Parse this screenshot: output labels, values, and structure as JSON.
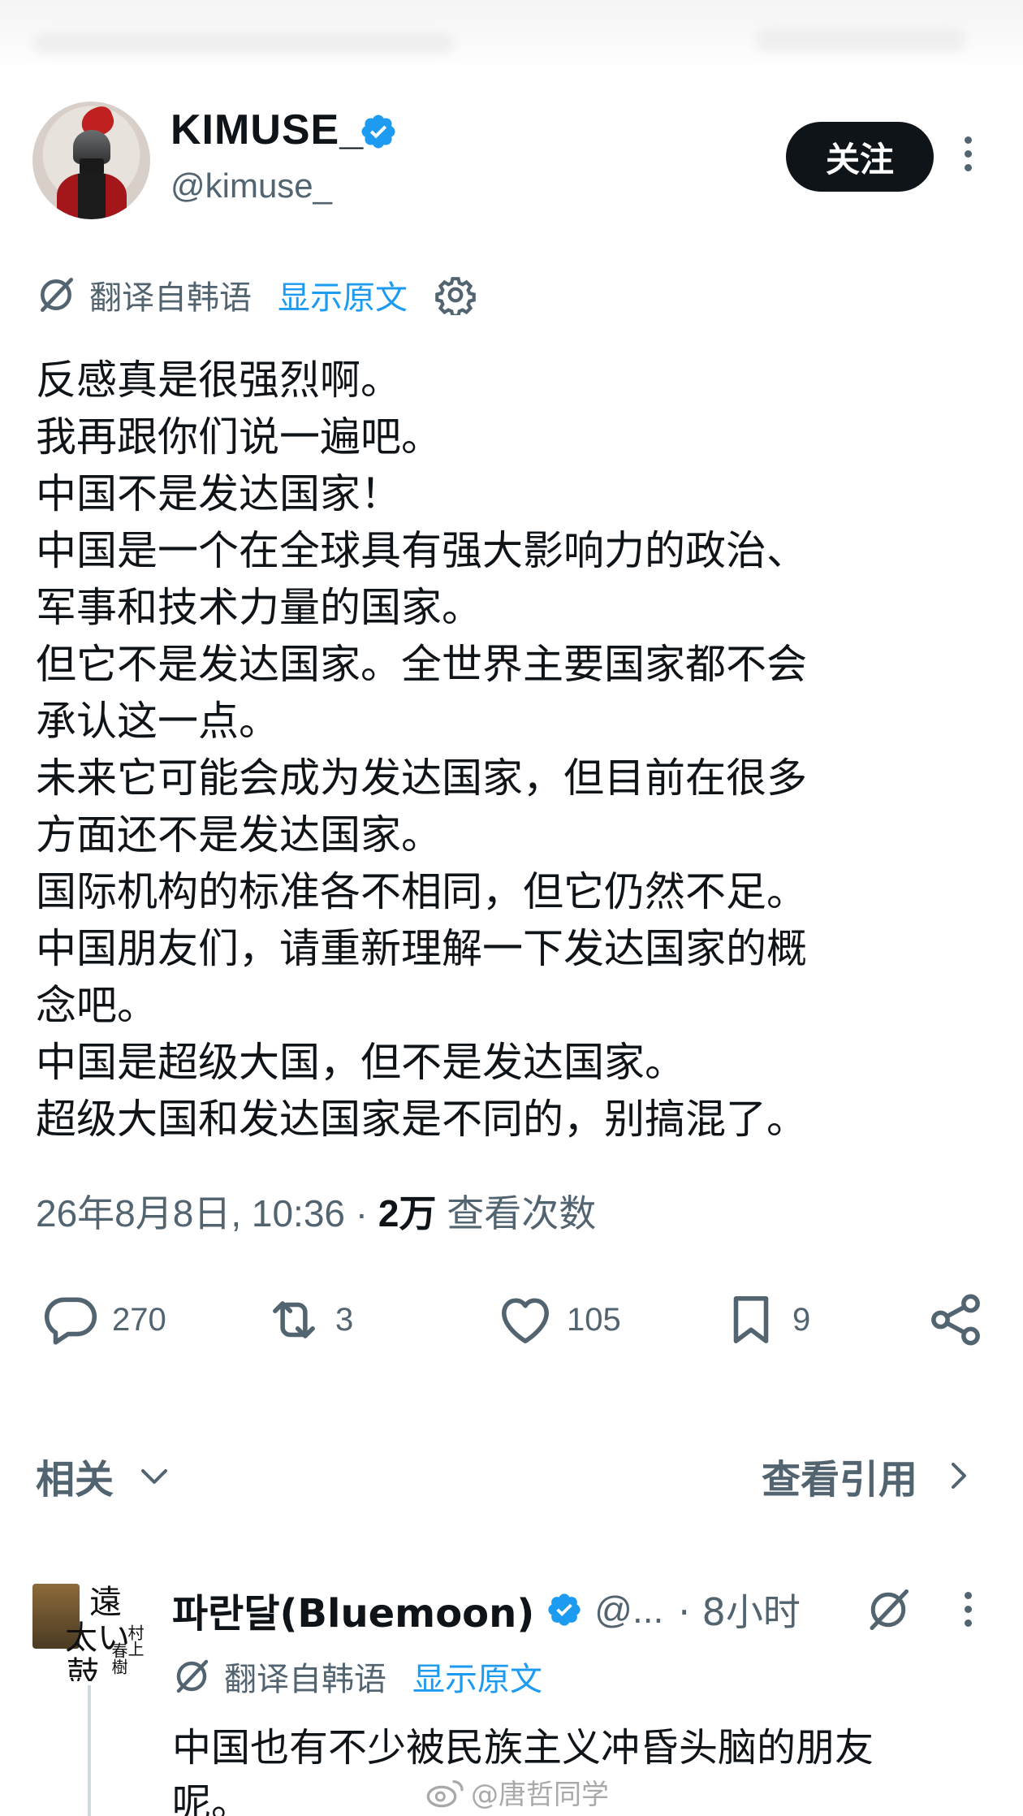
{
  "header": {
    "display_name": "KIMUSE_",
    "handle": "@kimuse_",
    "follow_label": "关注"
  },
  "translation": {
    "label": "翻译自韩语",
    "show_original": "显示原文"
  },
  "tweet": {
    "text": "反感真是很强烈啊。\n我再跟你们说一遍吧。\n中国不是发达国家！\n中国是一个在全球具有强大影响力的政治、\n军事和技术力量的国家。\n但它不是发达国家。全世界主要国家都不会\n承认这一点。\n未来它可能会成为发达国家，但目前在很多\n方面还不是发达国家。\n国际机构的标准各不相同，但它仍然不足。\n中国朋友们，请重新理解一下发达国家的概\n念吧。\n中国是超级大国，但不是发达国家。\n超级大国和发达国家是不同的，别搞混了。",
    "date": "26年8月8日, 10:36",
    "separator": " · ",
    "views": "2万",
    "views_label": " 查看次数"
  },
  "actions": {
    "replies": "270",
    "reposts": "3",
    "likes": "105",
    "bookmarks": "9"
  },
  "related": {
    "label": "相关",
    "quotes_label": "查看引用"
  },
  "reply": {
    "avatar_text": [
      "遠",
      "太い",
      "鼓",
      "村上",
      "春樹"
    ],
    "name": "파란달(Bluemoon)",
    "handle": "@...",
    "time": "· 8小时",
    "translation_label": "翻译自韩语",
    "show_original": "显示原文",
    "text": "中国也有不少被民族主义冲昏头脑的朋友\n呢。"
  },
  "watermark": "@唐哲同学",
  "colors": {
    "accent": "#1d9bf0",
    "text": "#0f1419",
    "secondary": "#536471",
    "button_bg": "#0f1419"
  }
}
